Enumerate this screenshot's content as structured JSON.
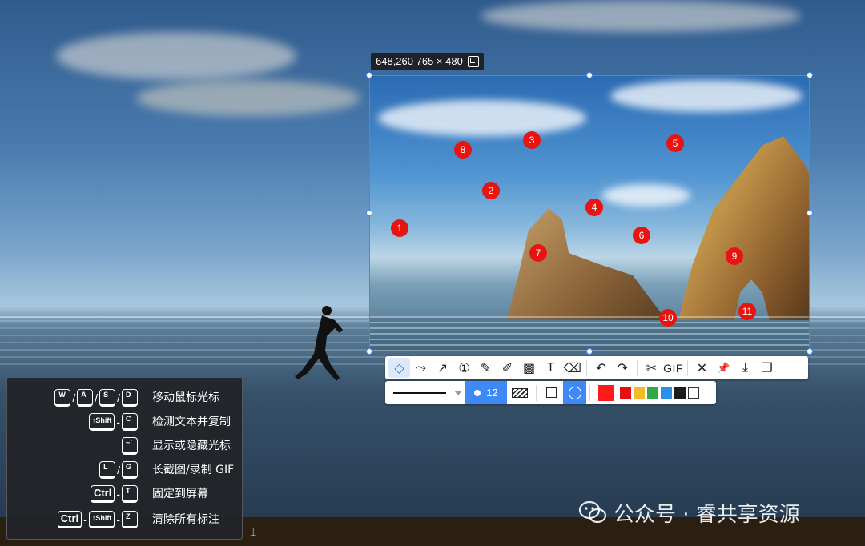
{
  "selection": {
    "info_text": "648,260  765 × 480",
    "fullscreen_icon": "expand-square-icon"
  },
  "markers": [
    "1",
    "2",
    "3",
    "4",
    "5",
    "6",
    "7",
    "8",
    "9",
    "10",
    "11"
  ],
  "toolbar": {
    "tools": [
      {
        "name": "shape-select-icon",
        "glyph": "◇",
        "active": true
      },
      {
        "name": "polyline-icon",
        "glyph": "⤳"
      },
      {
        "name": "arrow-icon",
        "glyph": "↗"
      },
      {
        "name": "number-marker-icon",
        "glyph": "①"
      },
      {
        "name": "pencil-icon",
        "glyph": "✎"
      },
      {
        "name": "highlighter-icon",
        "glyph": "✐"
      },
      {
        "name": "mosaic-icon",
        "glyph": "▩"
      },
      {
        "name": "text-icon",
        "glyph": "T"
      },
      {
        "name": "eraser-icon",
        "glyph": "⌫"
      },
      {
        "name": "undo-icon",
        "glyph": "↶"
      },
      {
        "name": "redo-icon",
        "glyph": "↷"
      },
      {
        "name": "long-screenshot-icon",
        "glyph": "✂"
      },
      {
        "name": "gif-label",
        "glyph": "GIF"
      },
      {
        "name": "close-icon",
        "glyph": "✕"
      },
      {
        "name": "pin-icon",
        "glyph": "📌"
      },
      {
        "name": "download-icon",
        "glyph": "⤓"
      },
      {
        "name": "copy-icon",
        "glyph": "❐"
      }
    ]
  },
  "options": {
    "size_value": "12",
    "colors": [
      "#ff1a1a",
      "#e60f0f",
      "#f5b92c",
      "#2fa84a",
      "#2b8fe8",
      "#1c1c1c",
      "#ffffff"
    ],
    "selected_color": "#ff1a1a"
  },
  "shortcuts": [
    {
      "keys": [
        "W",
        "/",
        "A",
        "/",
        "S",
        "/",
        "D"
      ],
      "desc": "移动鼠标光标"
    },
    {
      "keys": [
        "↑Shift",
        "-",
        "C"
      ],
      "desc": "检测文本并复制"
    },
    {
      "keys": [
        "~`"
      ],
      "desc": "显示或隐藏光标"
    },
    {
      "keys": [
        "L",
        "/",
        "G"
      ],
      "desc": "长截图/录制 GIF"
    },
    {
      "keys": [
        "Ctrl",
        "-",
        "T"
      ],
      "desc": "固定到屏幕"
    },
    {
      "keys": [
        "Ctrl",
        "-",
        "↑Shift",
        "-",
        "Z"
      ],
      "desc": "清除所有标注"
    }
  ],
  "watermark": {
    "text": "公众号 · 睿共享资源",
    "icon": "wechat-icon"
  }
}
